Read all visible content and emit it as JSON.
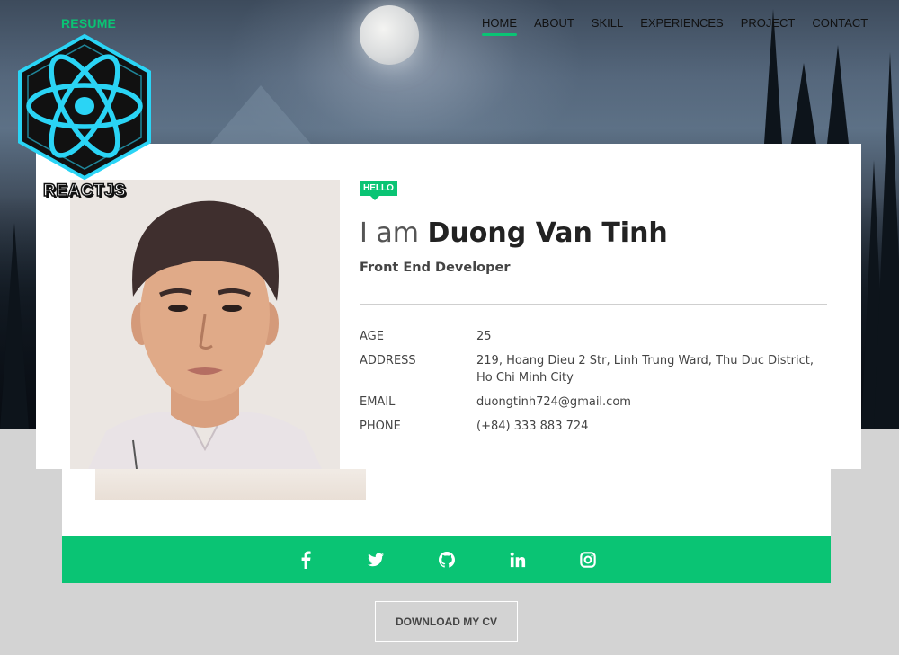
{
  "brand": "RESUME",
  "nav": {
    "items": [
      {
        "label": "HOME",
        "active": true
      },
      {
        "label": "ABOUT",
        "active": false
      },
      {
        "label": "SKILL",
        "active": false
      },
      {
        "label": "EXPERIENCES",
        "active": false
      },
      {
        "label": "PROJECT",
        "active": false
      },
      {
        "label": "CONTACT",
        "active": false
      }
    ]
  },
  "badge": {
    "label": "REACTJS",
    "icon": "react-atom-icon"
  },
  "profile": {
    "hello": "HELLO",
    "heading_prefix": "I am",
    "name": "Duong Van Tinh",
    "role": "Front End Developer",
    "info": [
      {
        "key": "AGE",
        "value": "25"
      },
      {
        "key": "ADDRESS",
        "value": "219, Hoang Dieu 2 Str, Linh Trung Ward, Thu Duc District, Ho Chi Minh City"
      },
      {
        "key": "EMAIL",
        "value": "duongtinh724@gmail.com"
      },
      {
        "key": "PHONE",
        "value": "(+84) 333 883 724"
      }
    ]
  },
  "social": [
    "facebook-icon",
    "twitter-icon",
    "github-icon",
    "linkedin-icon",
    "instagram-icon"
  ],
  "download_label": "DOWNLOAD MY CV",
  "colors": {
    "accent": "#0ac474",
    "page_bg": "#d3d3d3",
    "card_bg": "#ffffff",
    "badge_cyan": "#2ad4f5"
  }
}
